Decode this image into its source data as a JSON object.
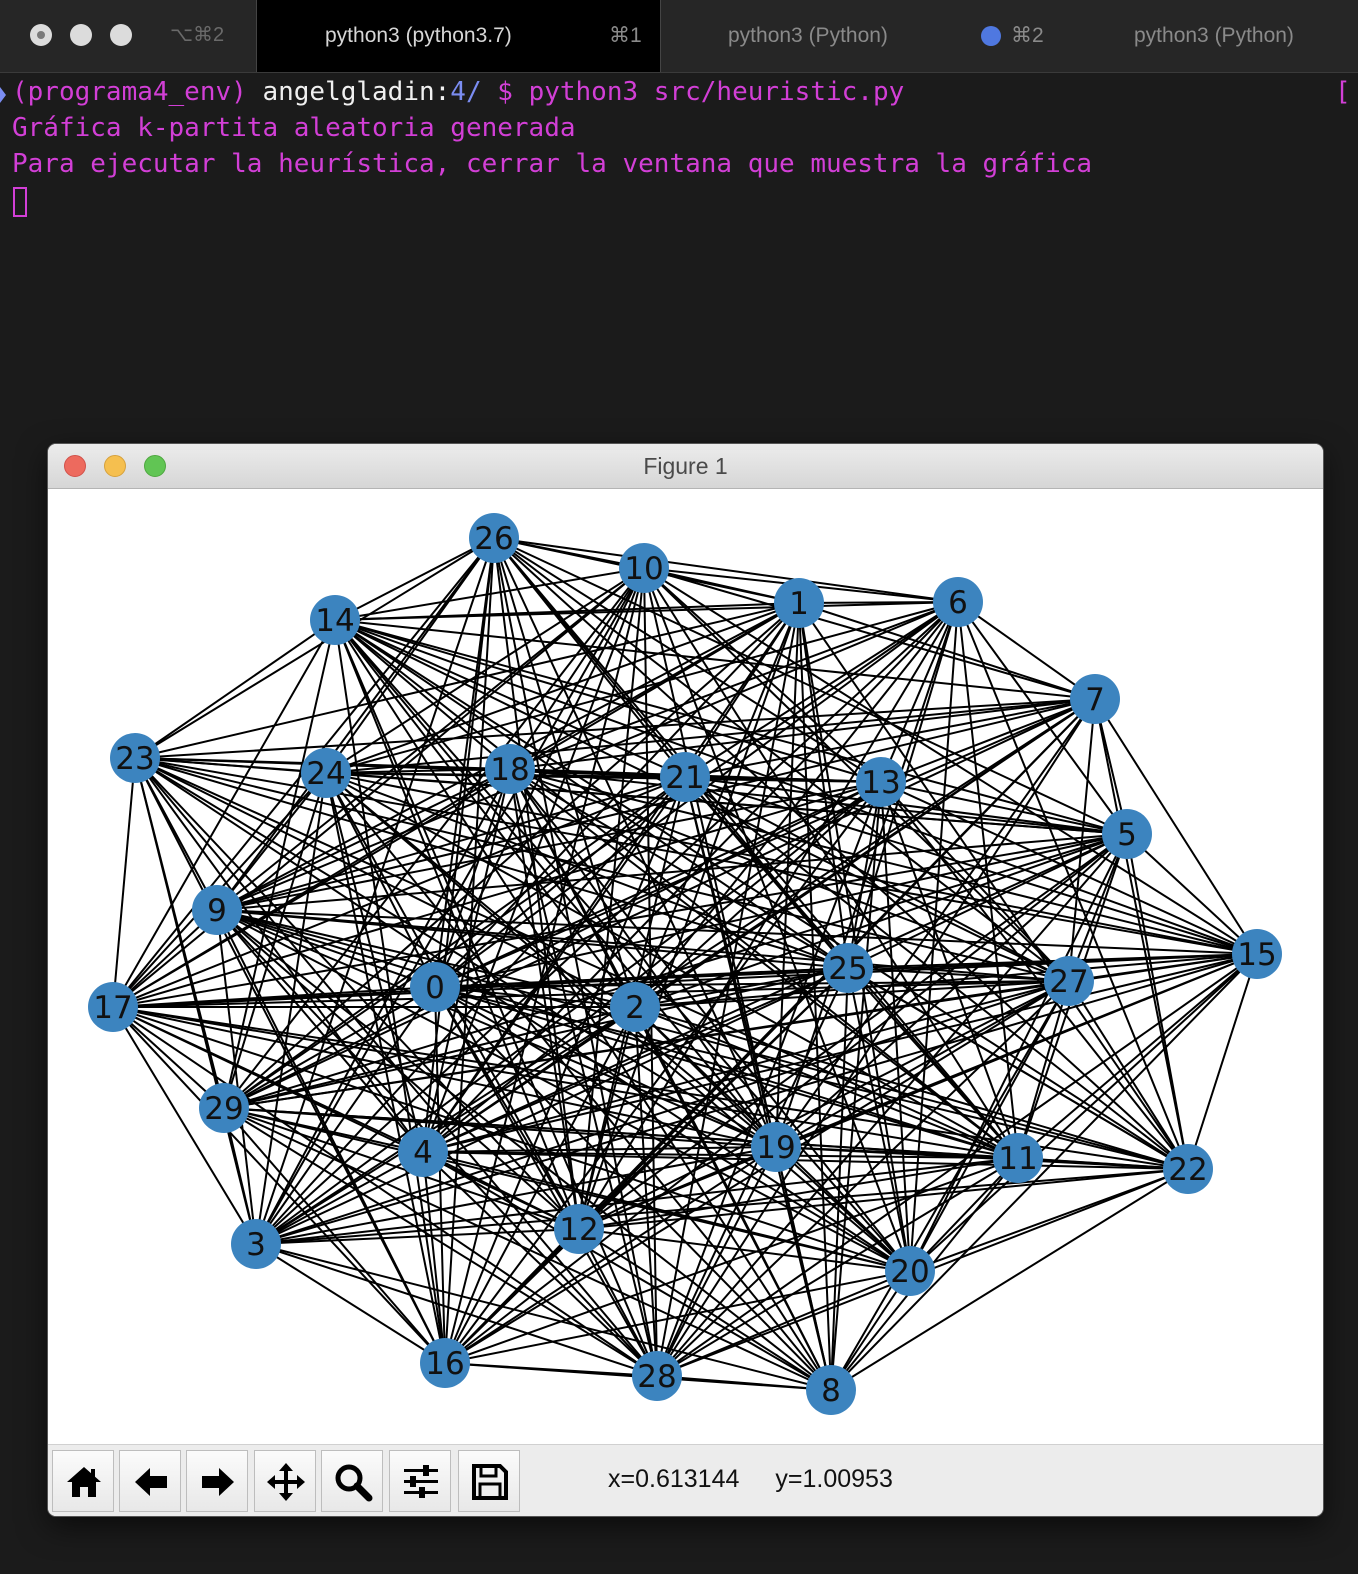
{
  "tabbar": {
    "first_shortcut": "⌥⌘2",
    "tabs": [
      {
        "title": "python3 (python3.7)",
        "shortcut": "⌘1",
        "active": true
      },
      {
        "title": "python3 (Python)",
        "shortcut": "⌘2",
        "active": false,
        "activity_dot": true
      },
      {
        "title": "python3 (Python)",
        "shortcut": "",
        "active": false
      }
    ]
  },
  "terminal": {
    "prompt_env": "(programa4_env) ",
    "prompt_user": "angelgladin",
    "prompt_sep": ":",
    "prompt_path": "4/",
    "prompt_rest": " $ python3 src/heuristic.py",
    "right_marker": "[",
    "output": [
      "Gráfica k-partita aleatoria generada",
      "Para ejecutar la heurística, cerrar la ventana que muestra la gráfica"
    ]
  },
  "figure": {
    "title": "Figure 1",
    "node_color": "#3c84bf",
    "edge_color": "#000000",
    "toolbar": {
      "buttons": [
        "home-icon",
        "back-arrow-icon",
        "forward-arrow-icon",
        "pan-icon",
        "zoom-icon",
        "configure-subplots-icon",
        "save-icon"
      ],
      "x_readout": "x=0.613144",
      "y_readout": "y=1.00953"
    }
  },
  "chart_data": {
    "type": "graph",
    "nodes": [
      "26",
      "10",
      "1",
      "6",
      "14",
      "7",
      "23",
      "24",
      "18",
      "21",
      "13",
      "5",
      "9",
      "15",
      "25",
      "27",
      "0",
      "2",
      "17",
      "29",
      "4",
      "19",
      "11",
      "22",
      "3",
      "12",
      "20",
      "16",
      "28",
      "8"
    ],
    "edge_pairs_note": "",
    "edges": [
      [
        "26",
        "10"
      ],
      [
        "26",
        "1"
      ],
      [
        "26",
        "6"
      ],
      [
        "26",
        "14"
      ],
      [
        "26",
        "23"
      ],
      [
        "26",
        "24"
      ],
      [
        "26",
        "21"
      ],
      [
        "26",
        "13"
      ],
      [
        "26",
        "5"
      ],
      [
        "26",
        "9"
      ],
      [
        "26",
        "25"
      ],
      [
        "26",
        "27"
      ],
      [
        "26",
        "0"
      ],
      [
        "26",
        "2"
      ],
      [
        "26",
        "17"
      ],
      [
        "26",
        "4"
      ],
      [
        "26",
        "19"
      ],
      [
        "26",
        "11"
      ],
      [
        "26",
        "3"
      ],
      [
        "26",
        "12"
      ],
      [
        "26",
        "16"
      ],
      [
        "26",
        "28"
      ],
      [
        "26",
        "22"
      ],
      [
        "10",
        "1"
      ],
      [
        "10",
        "6"
      ],
      [
        "10",
        "14"
      ],
      [
        "10",
        "7"
      ],
      [
        "10",
        "24"
      ],
      [
        "10",
        "18"
      ],
      [
        "10",
        "13"
      ],
      [
        "10",
        "9"
      ],
      [
        "10",
        "15"
      ],
      [
        "10",
        "27"
      ],
      [
        "10",
        "0"
      ],
      [
        "10",
        "17"
      ],
      [
        "10",
        "29"
      ],
      [
        "10",
        "4"
      ],
      [
        "10",
        "11"
      ],
      [
        "10",
        "3"
      ],
      [
        "10",
        "12"
      ],
      [
        "10",
        "20"
      ],
      [
        "10",
        "16"
      ],
      [
        "10",
        "28"
      ],
      [
        "10",
        "8"
      ],
      [
        "1",
        "6"
      ],
      [
        "1",
        "14"
      ],
      [
        "1",
        "7"
      ],
      [
        "1",
        "23"
      ],
      [
        "1",
        "24"
      ],
      [
        "1",
        "18"
      ],
      [
        "1",
        "21"
      ],
      [
        "1",
        "9"
      ],
      [
        "1",
        "25"
      ],
      [
        "1",
        "0"
      ],
      [
        "1",
        "2"
      ],
      [
        "1",
        "17"
      ],
      [
        "1",
        "29"
      ],
      [
        "1",
        "4"
      ],
      [
        "1",
        "19"
      ],
      [
        "1",
        "20"
      ],
      [
        "1",
        "12"
      ],
      [
        "1",
        "8"
      ],
      [
        "1",
        "28"
      ],
      [
        "1",
        "22"
      ],
      [
        "6",
        "14"
      ],
      [
        "6",
        "7"
      ],
      [
        "6",
        "24"
      ],
      [
        "6",
        "18"
      ],
      [
        "6",
        "21"
      ],
      [
        "6",
        "13"
      ],
      [
        "6",
        "5"
      ],
      [
        "6",
        "9"
      ],
      [
        "6",
        "25"
      ],
      [
        "6",
        "0"
      ],
      [
        "6",
        "2"
      ],
      [
        "6",
        "29"
      ],
      [
        "6",
        "4"
      ],
      [
        "6",
        "19"
      ],
      [
        "6",
        "11"
      ],
      [
        "6",
        "3"
      ],
      [
        "6",
        "12"
      ],
      [
        "6",
        "22"
      ],
      [
        "6",
        "20"
      ],
      [
        "14",
        "7"
      ],
      [
        "14",
        "23"
      ],
      [
        "14",
        "18"
      ],
      [
        "14",
        "21"
      ],
      [
        "14",
        "13"
      ],
      [
        "14",
        "5"
      ],
      [
        "14",
        "15"
      ],
      [
        "14",
        "25"
      ],
      [
        "14",
        "27"
      ],
      [
        "14",
        "2"
      ],
      [
        "14",
        "17"
      ],
      [
        "14",
        "29"
      ],
      [
        "14",
        "19"
      ],
      [
        "14",
        "11"
      ],
      [
        "14",
        "12"
      ],
      [
        "14",
        "20"
      ],
      [
        "14",
        "16"
      ],
      [
        "14",
        "28"
      ],
      [
        "14",
        "8"
      ],
      [
        "14",
        "22"
      ],
      [
        "7",
        "23"
      ],
      [
        "7",
        "24"
      ],
      [
        "7",
        "18"
      ],
      [
        "7",
        "21"
      ],
      [
        "7",
        "13"
      ],
      [
        "7",
        "5"
      ],
      [
        "7",
        "9"
      ],
      [
        "7",
        "15"
      ],
      [
        "7",
        "27"
      ],
      [
        "7",
        "0"
      ],
      [
        "7",
        "2"
      ],
      [
        "7",
        "29"
      ],
      [
        "7",
        "4"
      ],
      [
        "7",
        "19"
      ],
      [
        "7",
        "12"
      ],
      [
        "7",
        "3"
      ],
      [
        "7",
        "22"
      ],
      [
        "7",
        "16"
      ],
      [
        "7",
        "28"
      ],
      [
        "23",
        "24"
      ],
      [
        "23",
        "18"
      ],
      [
        "23",
        "21"
      ],
      [
        "23",
        "13"
      ],
      [
        "23",
        "5"
      ],
      [
        "23",
        "9"
      ],
      [
        "23",
        "15"
      ],
      [
        "23",
        "25"
      ],
      [
        "23",
        "27"
      ],
      [
        "23",
        "2"
      ],
      [
        "23",
        "17"
      ],
      [
        "23",
        "29"
      ],
      [
        "23",
        "4"
      ],
      [
        "23",
        "19"
      ],
      [
        "23",
        "11"
      ],
      [
        "23",
        "3"
      ],
      [
        "23",
        "12"
      ],
      [
        "23",
        "20"
      ],
      [
        "23",
        "16"
      ],
      [
        "23",
        "28"
      ],
      [
        "24",
        "18"
      ],
      [
        "24",
        "21"
      ],
      [
        "24",
        "13"
      ],
      [
        "24",
        "5"
      ],
      [
        "24",
        "9"
      ],
      [
        "24",
        "15"
      ],
      [
        "24",
        "25"
      ],
      [
        "24",
        "0"
      ],
      [
        "24",
        "17"
      ],
      [
        "24",
        "29"
      ],
      [
        "24",
        "4"
      ],
      [
        "24",
        "19"
      ],
      [
        "24",
        "11"
      ],
      [
        "24",
        "3"
      ],
      [
        "24",
        "12"
      ],
      [
        "24",
        "20"
      ],
      [
        "24",
        "16"
      ],
      [
        "24",
        "8"
      ],
      [
        "18",
        "21"
      ],
      [
        "18",
        "13"
      ],
      [
        "18",
        "5"
      ],
      [
        "18",
        "9"
      ],
      [
        "18",
        "15"
      ],
      [
        "18",
        "27"
      ],
      [
        "18",
        "0"
      ],
      [
        "18",
        "2"
      ],
      [
        "18",
        "17"
      ],
      [
        "18",
        "4"
      ],
      [
        "18",
        "19"
      ],
      [
        "18",
        "11"
      ],
      [
        "18",
        "22"
      ],
      [
        "18",
        "3"
      ],
      [
        "18",
        "12"
      ],
      [
        "18",
        "20"
      ],
      [
        "18",
        "28"
      ],
      [
        "18",
        "8"
      ],
      [
        "21",
        "13"
      ],
      [
        "21",
        "5"
      ],
      [
        "21",
        "9"
      ],
      [
        "21",
        "15"
      ],
      [
        "21",
        "25"
      ],
      [
        "21",
        "27"
      ],
      [
        "21",
        "0"
      ],
      [
        "21",
        "17"
      ],
      [
        "21",
        "29"
      ],
      [
        "21",
        "4"
      ],
      [
        "21",
        "19"
      ],
      [
        "21",
        "11"
      ],
      [
        "21",
        "22"
      ],
      [
        "21",
        "3"
      ],
      [
        "21",
        "12"
      ],
      [
        "21",
        "16"
      ],
      [
        "21",
        "8"
      ],
      [
        "13",
        "5"
      ],
      [
        "13",
        "9"
      ],
      [
        "13",
        "15"
      ],
      [
        "13",
        "25"
      ],
      [
        "13",
        "27"
      ],
      [
        "13",
        "0"
      ],
      [
        "13",
        "2"
      ],
      [
        "13",
        "17"
      ],
      [
        "13",
        "29"
      ],
      [
        "13",
        "4"
      ],
      [
        "13",
        "11"
      ],
      [
        "13",
        "22"
      ],
      [
        "13",
        "3"
      ],
      [
        "13",
        "20"
      ],
      [
        "13",
        "16"
      ],
      [
        "13",
        "28"
      ],
      [
        "13",
        "8"
      ],
      [
        "5",
        "9"
      ],
      [
        "5",
        "15"
      ],
      [
        "5",
        "25"
      ],
      [
        "5",
        "27"
      ],
      [
        "5",
        "0"
      ],
      [
        "5",
        "2"
      ],
      [
        "5",
        "17"
      ],
      [
        "5",
        "29"
      ],
      [
        "5",
        "4"
      ],
      [
        "5",
        "19"
      ],
      [
        "5",
        "11"
      ],
      [
        "5",
        "22"
      ],
      [
        "5",
        "12"
      ],
      [
        "5",
        "20"
      ],
      [
        "5",
        "16"
      ],
      [
        "5",
        "28"
      ],
      [
        "9",
        "15"
      ],
      [
        "9",
        "25"
      ],
      [
        "9",
        "27"
      ],
      [
        "9",
        "0"
      ],
      [
        "9",
        "2"
      ],
      [
        "9",
        "17"
      ],
      [
        "9",
        "4"
      ],
      [
        "9",
        "19"
      ],
      [
        "9",
        "11"
      ],
      [
        "9",
        "22"
      ],
      [
        "9",
        "3"
      ],
      [
        "9",
        "12"
      ],
      [
        "9",
        "20"
      ],
      [
        "9",
        "16"
      ],
      [
        "9",
        "28"
      ],
      [
        "9",
        "8"
      ],
      [
        "15",
        "25"
      ],
      [
        "15",
        "27"
      ],
      [
        "15",
        "0"
      ],
      [
        "15",
        "2"
      ],
      [
        "15",
        "17"
      ],
      [
        "15",
        "29"
      ],
      [
        "15",
        "4"
      ],
      [
        "15",
        "19"
      ],
      [
        "15",
        "11"
      ],
      [
        "15",
        "22"
      ],
      [
        "15",
        "3"
      ],
      [
        "15",
        "12"
      ],
      [
        "15",
        "20"
      ],
      [
        "15",
        "28"
      ],
      [
        "15",
        "8"
      ],
      [
        "25",
        "27"
      ],
      [
        "25",
        "0"
      ],
      [
        "25",
        "2"
      ],
      [
        "25",
        "17"
      ],
      [
        "25",
        "29"
      ],
      [
        "25",
        "4"
      ],
      [
        "25",
        "11"
      ],
      [
        "25",
        "22"
      ],
      [
        "25",
        "3"
      ],
      [
        "25",
        "12"
      ],
      [
        "25",
        "20"
      ],
      [
        "25",
        "16"
      ],
      [
        "25",
        "28"
      ],
      [
        "25",
        "8"
      ],
      [
        "27",
        "0"
      ],
      [
        "27",
        "2"
      ],
      [
        "27",
        "17"
      ],
      [
        "27",
        "29"
      ],
      [
        "27",
        "4"
      ],
      [
        "27",
        "19"
      ],
      [
        "27",
        "11"
      ],
      [
        "27",
        "22"
      ],
      [
        "27",
        "3"
      ],
      [
        "27",
        "12"
      ],
      [
        "27",
        "20"
      ],
      [
        "27",
        "16"
      ],
      [
        "27",
        "28"
      ],
      [
        "27",
        "8"
      ],
      [
        "0",
        "2"
      ],
      [
        "0",
        "17"
      ],
      [
        "0",
        "29"
      ],
      [
        "0",
        "19"
      ],
      [
        "0",
        "11"
      ],
      [
        "0",
        "22"
      ],
      [
        "0",
        "3"
      ],
      [
        "0",
        "12"
      ],
      [
        "0",
        "20"
      ],
      [
        "0",
        "16"
      ],
      [
        "0",
        "28"
      ],
      [
        "0",
        "8"
      ],
      [
        "2",
        "17"
      ],
      [
        "2",
        "29"
      ],
      [
        "2",
        "4"
      ],
      [
        "2",
        "19"
      ],
      [
        "2",
        "11"
      ],
      [
        "2",
        "22"
      ],
      [
        "2",
        "3"
      ],
      [
        "2",
        "12"
      ],
      [
        "2",
        "20"
      ],
      [
        "2",
        "16"
      ],
      [
        "2",
        "28"
      ],
      [
        "2",
        "8"
      ],
      [
        "17",
        "29"
      ],
      [
        "17",
        "4"
      ],
      [
        "17",
        "19"
      ],
      [
        "17",
        "11"
      ],
      [
        "17",
        "22"
      ],
      [
        "17",
        "3"
      ],
      [
        "17",
        "12"
      ],
      [
        "17",
        "20"
      ],
      [
        "17",
        "16"
      ],
      [
        "17",
        "28"
      ],
      [
        "29",
        "4"
      ],
      [
        "29",
        "19"
      ],
      [
        "29",
        "11"
      ],
      [
        "29",
        "22"
      ],
      [
        "29",
        "3"
      ],
      [
        "29",
        "12"
      ],
      [
        "29",
        "20"
      ],
      [
        "29",
        "16"
      ],
      [
        "29",
        "28"
      ],
      [
        "29",
        "8"
      ],
      [
        "4",
        "19"
      ],
      [
        "4",
        "11"
      ],
      [
        "4",
        "22"
      ],
      [
        "4",
        "3"
      ],
      [
        "4",
        "12"
      ],
      [
        "4",
        "20"
      ],
      [
        "4",
        "16"
      ],
      [
        "4",
        "28"
      ],
      [
        "4",
        "8"
      ],
      [
        "19",
        "11"
      ],
      [
        "19",
        "22"
      ],
      [
        "19",
        "3"
      ],
      [
        "19",
        "12"
      ],
      [
        "19",
        "20"
      ],
      [
        "19",
        "16"
      ],
      [
        "19",
        "28"
      ],
      [
        "19",
        "8"
      ],
      [
        "11",
        "22"
      ],
      [
        "11",
        "3"
      ],
      [
        "11",
        "12"
      ],
      [
        "11",
        "20"
      ],
      [
        "11",
        "16"
      ],
      [
        "11",
        "28"
      ],
      [
        "11",
        "8"
      ],
      [
        "22",
        "3"
      ],
      [
        "22",
        "12"
      ],
      [
        "22",
        "20"
      ],
      [
        "22",
        "28"
      ],
      [
        "22",
        "8"
      ],
      [
        "3",
        "12"
      ],
      [
        "3",
        "16"
      ],
      [
        "3",
        "28"
      ],
      [
        "3",
        "8"
      ],
      [
        "12",
        "20"
      ],
      [
        "12",
        "16"
      ],
      [
        "12",
        "28"
      ],
      [
        "12",
        "8"
      ],
      [
        "20",
        "16"
      ],
      [
        "20",
        "28"
      ],
      [
        "20",
        "8"
      ],
      [
        "16",
        "28"
      ],
      [
        "16",
        "8"
      ],
      [
        "28",
        "8"
      ]
    ]
  }
}
